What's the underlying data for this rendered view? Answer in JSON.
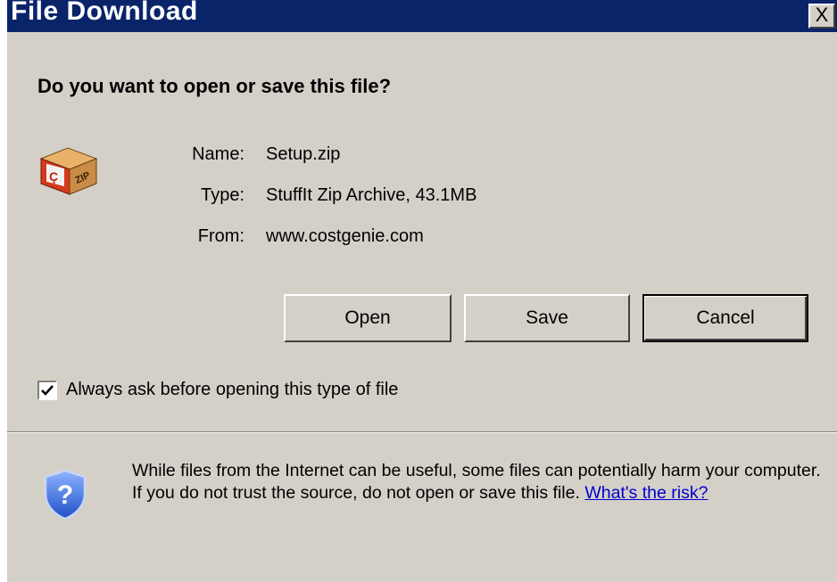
{
  "window": {
    "title": "File Download",
    "close_label": "X"
  },
  "dialog": {
    "question": "Do you want to open or save this file?",
    "file_icon": "zip-archive-icon",
    "name_label": "Name:",
    "name_value": "Setup.zip",
    "type_label": "Type:",
    "type_value": "StuffIt Zip Archive, 43.1MB",
    "from_label": "From:",
    "from_value": "www.costgenie.com"
  },
  "buttons": {
    "open_label": "Open",
    "save_label": "Save",
    "cancel_label": "Cancel"
  },
  "checkbox": {
    "label": "Always ask before opening this type of file",
    "checked": true
  },
  "warning": {
    "icon": "security-shield-question-icon",
    "text": "While files from the Internet can be useful, some files can potentially harm your computer. If you do not trust the source, do not open or save this file.",
    "link_label": "What's the risk?"
  },
  "colors": {
    "titlebar": "#0a246a",
    "dialog_face": "#d4d0c8",
    "link": "#0000cc"
  }
}
